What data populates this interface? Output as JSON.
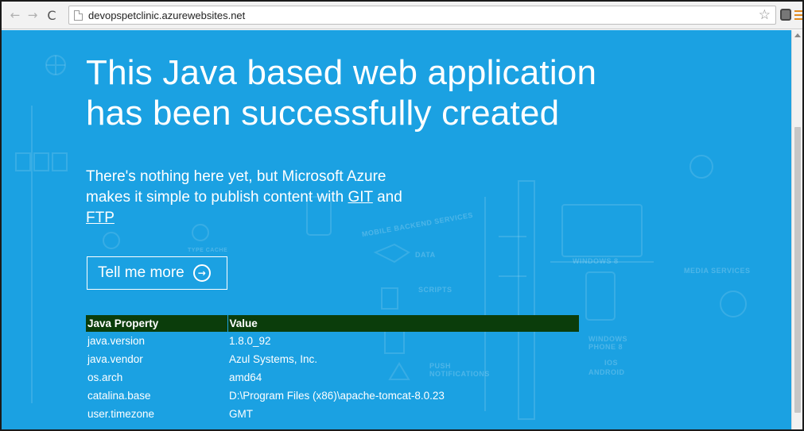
{
  "browser": {
    "url": "devopspetclinic.azurewebsites.net"
  },
  "page": {
    "headline": "This Java based web application has been successfully created",
    "lead_prefix": "There's nothing here yet, but Microsoft Azure makes it simple to publish content with ",
    "git_link": "GIT",
    "lead_and": " and ",
    "ftp_link": "FTP",
    "tell_more": "Tell me more"
  },
  "background_labels": {
    "mobile_backend": "Mobile Backend Services",
    "data": "Data",
    "scripts": "Scripts",
    "push": "Push Notifications",
    "windows8": "Windows 8",
    "windows_phone": "Windows Phone 8",
    "ios": "iOS",
    "android": "Android",
    "media": "Media Services",
    "cache": "Type Cache"
  },
  "properties": {
    "headers": [
      "Java Property",
      "Value"
    ],
    "rows": [
      {
        "name": "java.version",
        "value": "1.8.0_92"
      },
      {
        "name": "java.vendor",
        "value": "Azul Systems, Inc."
      },
      {
        "name": "os.arch",
        "value": "amd64"
      },
      {
        "name": "catalina.base",
        "value": "D:\\Program Files (x86)\\apache-tomcat-8.0.23"
      },
      {
        "name": "user.timezone",
        "value": "GMT"
      }
    ]
  },
  "colors": {
    "background": "#1ba1e2",
    "table_header": "#0b3d0b",
    "menu_accent": "#e08a1e"
  }
}
